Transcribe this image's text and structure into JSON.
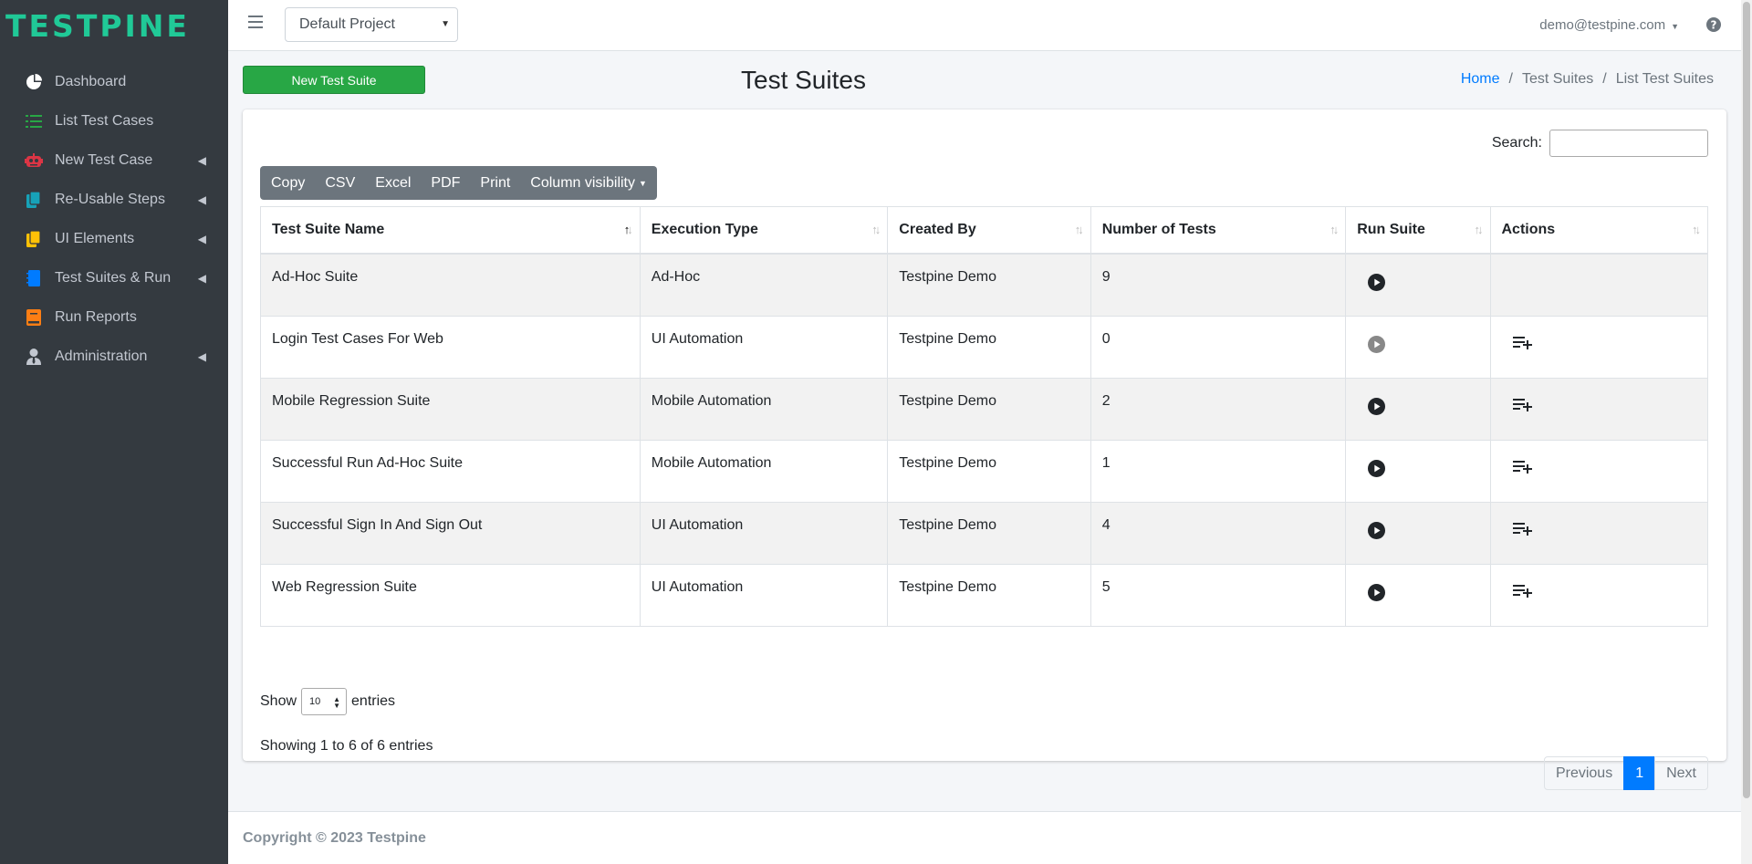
{
  "brand": "TESTPINE",
  "sidebar": {
    "items": [
      {
        "label": "Dashboard",
        "icon": "pie-chart-icon",
        "caret": false
      },
      {
        "label": "List Test Cases",
        "icon": "list-icon",
        "caret": false
      },
      {
        "label": "New Test Case",
        "icon": "robot-icon",
        "caret": true
      },
      {
        "label": "Re-Usable Steps",
        "icon": "copy-icon",
        "caret": true
      },
      {
        "label": "UI Elements",
        "icon": "copy-icon",
        "caret": true
      },
      {
        "label": "Test Suites & Run",
        "icon": "notebook-icon",
        "caret": true
      },
      {
        "label": "Run Reports",
        "icon": "book-icon",
        "caret": false
      },
      {
        "label": "Administration",
        "icon": "user-tie-icon",
        "caret": true
      }
    ]
  },
  "topbar": {
    "project": "Default Project",
    "user": "demo@testpine.com"
  },
  "page": {
    "new_button": "New Test Suite",
    "title": "Test Suites",
    "breadcrumb": [
      "Home",
      "Test Suites",
      "List Test Suites"
    ]
  },
  "table_tools": {
    "search_label": "Search:",
    "search_value": "",
    "buttons": [
      "Copy",
      "CSV",
      "Excel",
      "PDF",
      "Print",
      "Column visibility"
    ]
  },
  "table": {
    "headers": [
      "Test Suite Name",
      "Execution Type",
      "Created By",
      "Number of Tests",
      "Run Suite",
      "Actions"
    ],
    "rows": [
      {
        "name": "Ad-Hoc Suite",
        "type": "Ad-Hoc",
        "created_by": "Testpine Demo",
        "tests": "9",
        "run_enabled": true,
        "has_action": false
      },
      {
        "name": "Login Test Cases For Web",
        "type": "UI Automation",
        "created_by": "Testpine Demo",
        "tests": "0",
        "run_enabled": false,
        "has_action": true
      },
      {
        "name": "Mobile Regression Suite",
        "type": "Mobile Automation",
        "created_by": "Testpine Demo",
        "tests": "2",
        "run_enabled": true,
        "has_action": true
      },
      {
        "name": "Successful Run Ad-Hoc Suite",
        "type": "Mobile Automation",
        "created_by": "Testpine Demo",
        "tests": "1",
        "run_enabled": true,
        "has_action": true
      },
      {
        "name": "Successful Sign In And Sign Out",
        "type": "UI Automation",
        "created_by": "Testpine Demo",
        "tests": "4",
        "run_enabled": true,
        "has_action": true
      },
      {
        "name": "Web Regression Suite",
        "type": "UI Automation",
        "created_by": "Testpine Demo",
        "tests": "5",
        "run_enabled": true,
        "has_action": true
      }
    ]
  },
  "length": {
    "prefix": "Show",
    "value": "10",
    "suffix": "entries"
  },
  "info": "Showing 1 to 6 of 6 entries",
  "pagination": {
    "previous": "Previous",
    "current": "1",
    "next": "Next"
  },
  "footer": "Copyright © 2023 Testpine",
  "colors": {
    "brand": "#20c997",
    "sidebar": "#343a40",
    "primary_button": "#28a745",
    "link": "#007bff"
  }
}
